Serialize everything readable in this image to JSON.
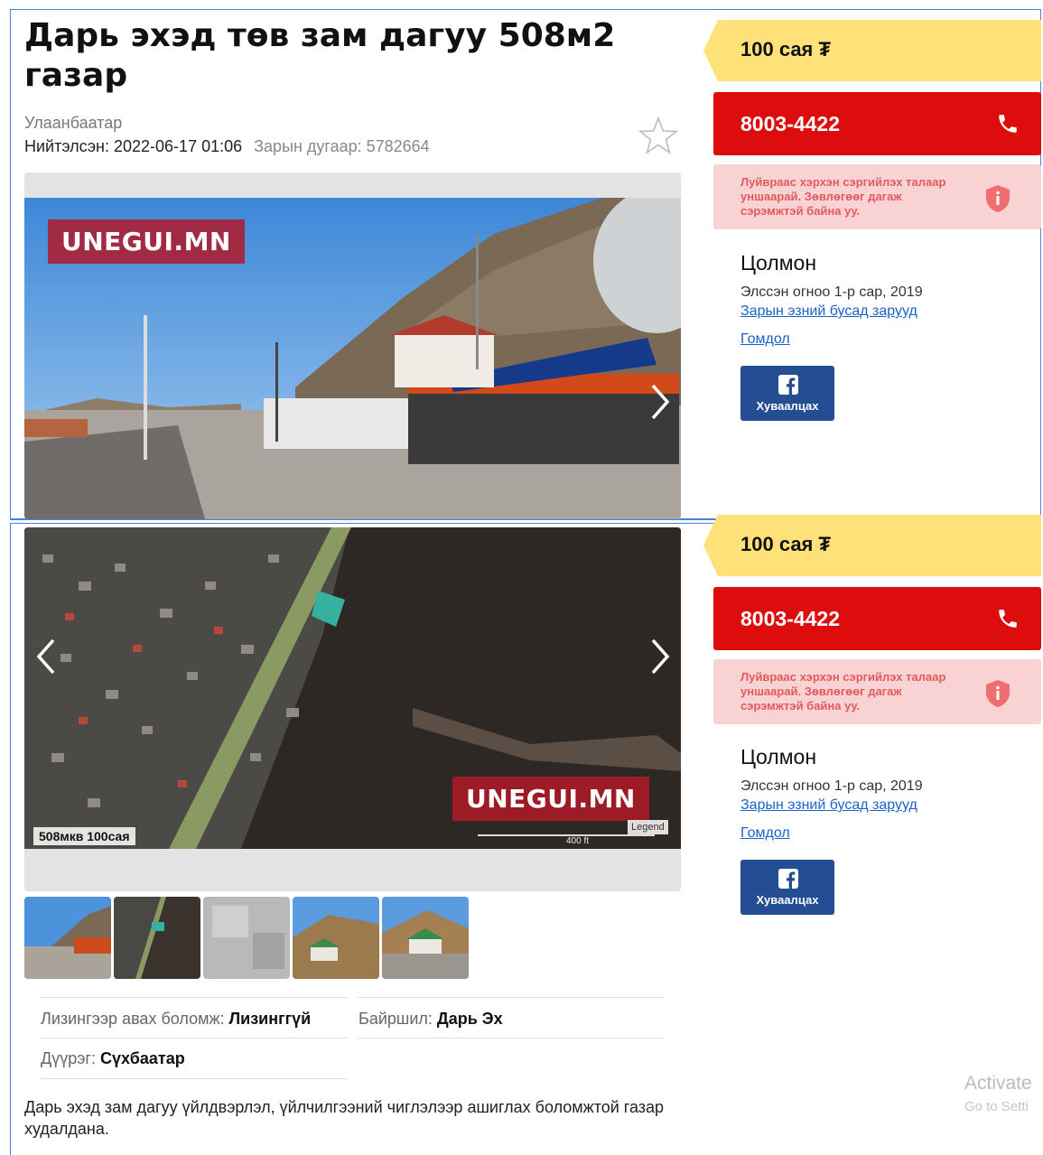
{
  "listing": {
    "title": "Дарь эхэд төв зам дагуу 508м2 газар",
    "city": "Улаанбаатар",
    "published_label": "Нийтэлсэн:",
    "published_date": "2022-06-17 01:06",
    "ad_number": "Зарын дугаар: 5782664"
  },
  "gallery": {
    "watermark": "UNEGUI.MN",
    "map_label": "508мкв 100сая",
    "map_scale": "400 ft",
    "map_legend": "Legend"
  },
  "properties": [
    {
      "label": "Лизингээр авах боломж:",
      "value": "Лизинггүй"
    },
    {
      "label": "Байршил:",
      "value": "Дарь Эх"
    },
    {
      "label": "Дүүрэг:",
      "value": "Сүхбаатар"
    }
  ],
  "description": "Дарь эхэд зам дагуу үйлдвэрлэл, үйлчилгээний чиглэлээр ашиглах боломжтой газар худалдана.",
  "sidebar": {
    "price": "100 сая ₮",
    "phone": "8003-4422",
    "warning": "Луйвраас хэрхэн сэргийлэх талаар уншаарай. Зөвлөгөөг дагаж сэрэмжтэй байна уу.",
    "seller": "Цолмон",
    "member_since": "Элссэн огноо 1-р сар, 2019",
    "other_ads": "Зарын эзний бусад зарууд",
    "complaint": "Гомдол",
    "share": "Хуваалцах"
  },
  "colors": {
    "price_bg": "#ffe17a",
    "phone_bg": "#dd0d0d",
    "warning_bg": "#f9d3d3",
    "share_bg": "#244e94",
    "link": "#1a63c8",
    "frame": "#4a86d4"
  },
  "overlay": {
    "activate_title": "Activate",
    "activate_sub": "Go to Setti"
  }
}
